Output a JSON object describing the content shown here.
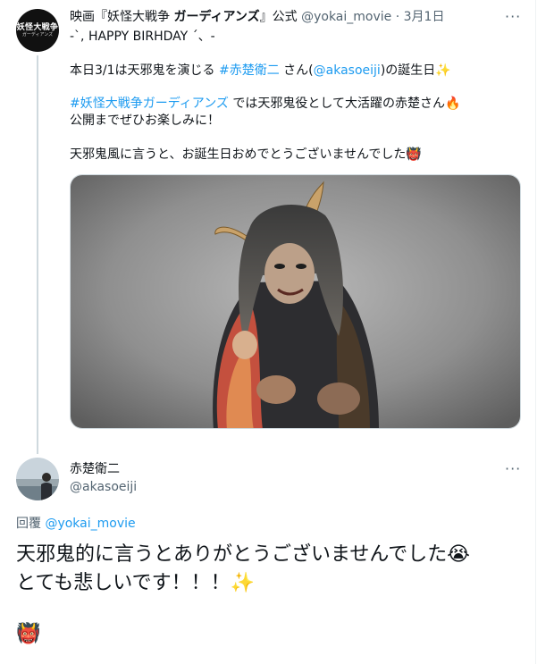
{
  "tweet": {
    "avatar_line1": "妖怪大戦争",
    "avatar_line2": "ガーディアンズ",
    "display_name_prefix": "映画『妖怪大戦争 ",
    "display_name_bold": "ガーディアンズ",
    "display_name_suffix": "』公式",
    "handle": "@yokai_movie",
    "separator": "·",
    "date": "3月1日",
    "more": "···",
    "line1": "-`, HAPPY BIRHDAY ´、-",
    "line2_a": "本日3/1は天邪鬼を演じる ",
    "line2_hashtag": "#赤楚衛二",
    "line2_b": " さん(",
    "line2_mention": "@akasoeiji",
    "line2_c": ")の誕生日",
    "line2_emoji": "✨",
    "line3_hashtag": "#妖怪大戦争ガーディアンズ",
    "line3_b": " では天邪鬼役として大活躍の赤楚さん",
    "line3_emoji": "🔥",
    "line4": "公開までぜひお楽しみに！",
    "line5": "天邪鬼風に言うと、お誕生日おめでとうございませんでした",
    "line5_emoji": "👹"
  },
  "reply": {
    "display_name": "赤楚衛二",
    "handle": "@akasoeiji",
    "more": "···",
    "reply_label": "回覆",
    "reply_mention": "@yokai_movie",
    "body_line1": "天邪鬼的に言うとありがとうございませんでした",
    "body_line1_emoji": "😭",
    "body_line2": "とても悲しいです！！！",
    "body_line2_emoji": "✨",
    "body_line3_emoji": "👹"
  },
  "colors": {
    "link": "#1d9bf0",
    "muted": "#536471",
    "thread_line": "#cfd9de"
  }
}
